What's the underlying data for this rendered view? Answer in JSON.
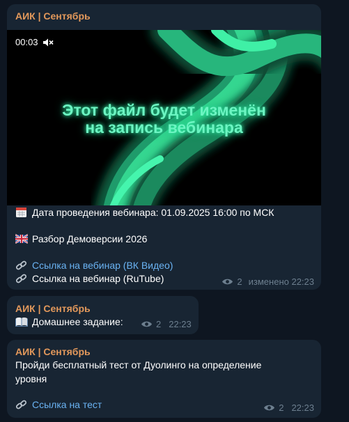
{
  "messages": [
    {
      "author": "АИК | Сентябрь",
      "video": {
        "time": "00:03",
        "title_line1": "Этот файл будет изменён",
        "title_line2": "на запись вебинара"
      },
      "date_line": "Дата проведения вебинара: 01.09.2025 16:00 по МСК",
      "topic_line": "Разбор Демоверсии 2026",
      "link1": "Ссылка на вебинар (ВК Видео)",
      "link2": "Ссылка на вебинар (RuTube)",
      "views": "2",
      "edited_time": "изменено 22:23"
    },
    {
      "author": "АИК | Сентябрь",
      "text": "Домашнее задание:",
      "views": "2",
      "time": "22:23"
    },
    {
      "author": "АИК | Сентябрь",
      "text_line1": "Пройди бесплатный тест от Дуолинго на определение",
      "text_line2": "уровня",
      "link": "Ссылка на тест",
      "views": "2",
      "time": "22:23"
    }
  ],
  "icons": {
    "calendar": "calendar-icon",
    "flag": "uk-flag-icon",
    "link": "link-icon",
    "book": "book-icon",
    "views": "eye-icon",
    "mute": "muted-speaker-icon"
  },
  "colors": {
    "background": "#0e1621",
    "bubble": "#182533",
    "author": "#e2985b",
    "link": "#6ab3f3",
    "meta": "#6d7f8f",
    "video_glow": "#2ee6a0"
  }
}
